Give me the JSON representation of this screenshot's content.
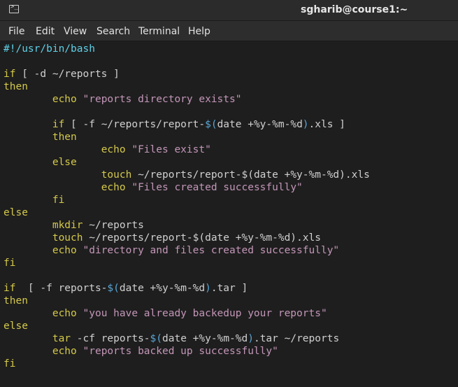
{
  "window": {
    "title": "sgharib@course1:~",
    "icon": "terminal-icon"
  },
  "menu": {
    "items": [
      "File",
      "Edit",
      "View",
      "Search",
      "Terminal",
      "Help"
    ]
  },
  "code": {
    "lines": [
      [
        {
          "t": "#!/usr/bin/bash",
          "c": "sh"
        }
      ],
      [],
      [
        {
          "t": "if",
          "c": "kw"
        },
        {
          "t": " [ -d ~/reports ]",
          "c": "plain"
        }
      ],
      [
        {
          "t": "then",
          "c": "kw"
        }
      ],
      [
        {
          "t": "        ",
          "c": "plain"
        },
        {
          "t": "echo",
          "c": "kw"
        },
        {
          "t": " ",
          "c": "plain"
        },
        {
          "t": "\"reports directory exists\"",
          "c": "str"
        }
      ],
      [],
      [
        {
          "t": "        ",
          "c": "plain"
        },
        {
          "t": "if",
          "c": "kw"
        },
        {
          "t": " [ -f ~/reports/report-",
          "c": "plain"
        },
        {
          "t": "$(",
          "c": "sb"
        },
        {
          "t": "date +%y-%m-%d",
          "c": "plain"
        },
        {
          "t": ")",
          "c": "sb"
        },
        {
          "t": ".xls ]",
          "c": "plain"
        }
      ],
      [
        {
          "t": "        ",
          "c": "plain"
        },
        {
          "t": "then",
          "c": "kw"
        }
      ],
      [
        {
          "t": "                ",
          "c": "plain"
        },
        {
          "t": "echo",
          "c": "kw"
        },
        {
          "t": " ",
          "c": "plain"
        },
        {
          "t": "\"Files exist\"",
          "c": "str"
        }
      ],
      [
        {
          "t": "        ",
          "c": "plain"
        },
        {
          "t": "else",
          "c": "kw"
        }
      ],
      [
        {
          "t": "                ",
          "c": "plain"
        },
        {
          "t": "touch",
          "c": "kw"
        },
        {
          "t": " ~/reports/report-$(date +%y-%m-%d).xls",
          "c": "plain"
        }
      ],
      [
        {
          "t": "                ",
          "c": "plain"
        },
        {
          "t": "echo",
          "c": "kw"
        },
        {
          "t": " ",
          "c": "plain"
        },
        {
          "t": "\"Files created successfully\"",
          "c": "str"
        }
      ],
      [
        {
          "t": "        ",
          "c": "plain"
        },
        {
          "t": "fi",
          "c": "kw"
        }
      ],
      [
        {
          "t": "else",
          "c": "kw"
        }
      ],
      [
        {
          "t": "        ",
          "c": "plain"
        },
        {
          "t": "mkdir",
          "c": "kw"
        },
        {
          "t": " ~/reports",
          "c": "plain"
        }
      ],
      [
        {
          "t": "        ",
          "c": "plain"
        },
        {
          "t": "touch",
          "c": "kw"
        },
        {
          "t": " ~/reports/report-$(date +%y-%m-%d).xls",
          "c": "plain"
        }
      ],
      [
        {
          "t": "        ",
          "c": "plain"
        },
        {
          "t": "echo",
          "c": "kw"
        },
        {
          "t": " ",
          "c": "plain"
        },
        {
          "t": "\"directory and files created successfully\"",
          "c": "str"
        }
      ],
      [
        {
          "t": "fi",
          "c": "kw"
        }
      ],
      [],
      [
        {
          "t": "if",
          "c": "kw"
        },
        {
          "t": "  [ -f reports-",
          "c": "plain"
        },
        {
          "t": "$(",
          "c": "sb"
        },
        {
          "t": "date +%y-%m-%d",
          "c": "plain"
        },
        {
          "t": ")",
          "c": "sb"
        },
        {
          "t": ".tar ]",
          "c": "plain"
        }
      ],
      [
        {
          "t": "then",
          "c": "kw"
        }
      ],
      [
        {
          "t": "        ",
          "c": "plain"
        },
        {
          "t": "echo",
          "c": "kw"
        },
        {
          "t": " ",
          "c": "plain"
        },
        {
          "t": "\"you have already backedup your reports\"",
          "c": "str"
        }
      ],
      [
        {
          "t": "else",
          "c": "kw"
        }
      ],
      [
        {
          "t": "        ",
          "c": "plain"
        },
        {
          "t": "tar",
          "c": "kw"
        },
        {
          "t": " -cf reports-",
          "c": "plain"
        },
        {
          "t": "$(",
          "c": "sb"
        },
        {
          "t": "date +%y-%m-%d",
          "c": "plain"
        },
        {
          "t": ")",
          "c": "sb"
        },
        {
          "t": ".tar ~/reports",
          "c": "plain"
        }
      ],
      [
        {
          "t": "        ",
          "c": "plain"
        },
        {
          "t": "echo",
          "c": "kw"
        },
        {
          "t": " ",
          "c": "plain"
        },
        {
          "t": "\"reports backed up successfully\"",
          "c": "str"
        }
      ],
      [
        {
          "t": "fi",
          "c": "kw"
        }
      ]
    ]
  }
}
